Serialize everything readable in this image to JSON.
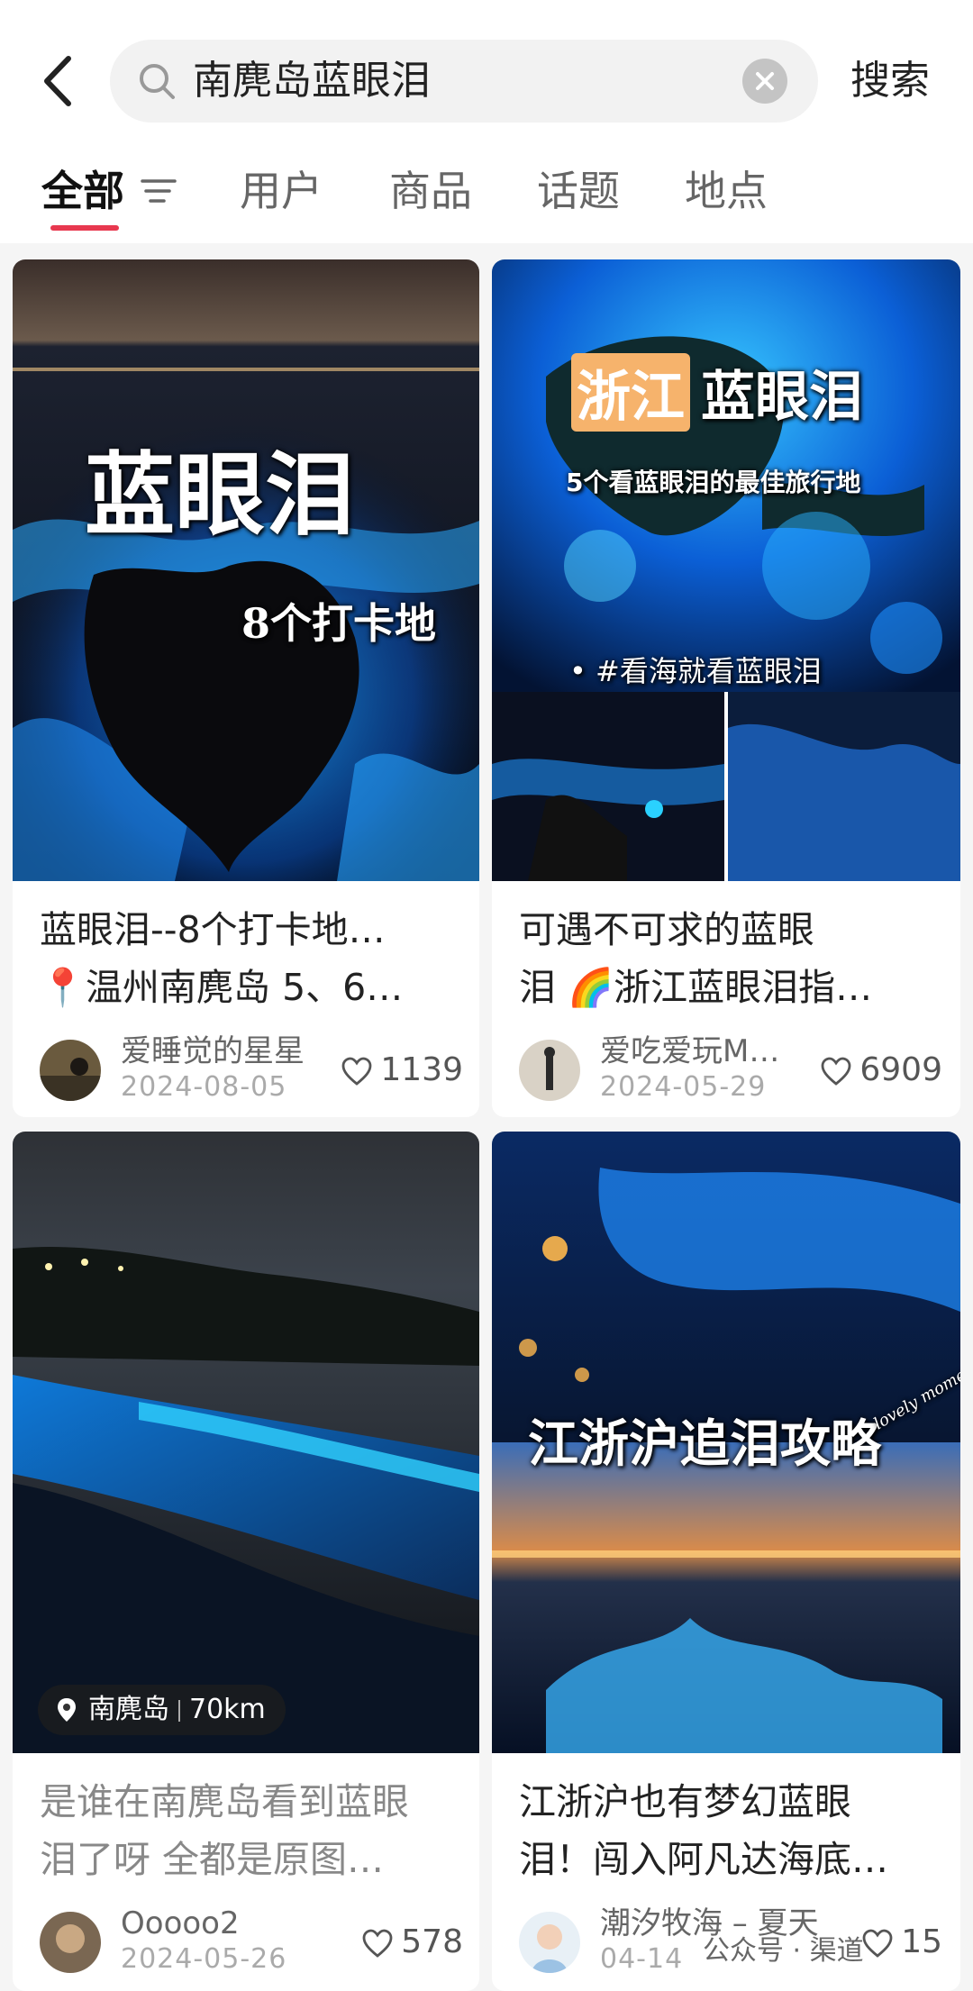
{
  "search": {
    "query": "南麂岛蓝眼泪",
    "submit_label": "搜索"
  },
  "tabs": [
    {
      "label": "全部"
    },
    {
      "label": "用户"
    },
    {
      "label": "商品"
    },
    {
      "label": "话题"
    },
    {
      "label": "地点"
    }
  ],
  "cards": [
    {
      "overlay_main": "蓝眼泪",
      "overlay_sub": "8个打卡地",
      "title_line1": "蓝眼泪--8个打卡地…",
      "title_line2": "📍温州南麂岛 5、6…",
      "author": "爱睡觉的星星",
      "date": "2024-08-05",
      "likes": "1139"
    },
    {
      "overlay_main_a": "浙江",
      "overlay_main_b": "蓝眼泪",
      "overlay_sub": "5个看蓝眼泪的最佳旅行地",
      "overlay_tag": "• #看海就看蓝眼泪",
      "title_line1": "可遇不可求的蓝眼",
      "title_line2": "泪 🌈浙江蓝眼泪指…",
      "author": "爱吃爱玩M…",
      "date": "2024-05-29",
      "likes": "6909"
    },
    {
      "location_name": "南麂岛",
      "location_distance": "70km",
      "title_line1": "是谁在南麂岛看到蓝眼",
      "title_line2": "泪了呀 全都是原图…",
      "author": "Ooooo2",
      "date": "2024-05-26",
      "likes": "578"
    },
    {
      "overlay_main": "江浙沪追泪攻略",
      "overlay_script": "lovely moments",
      "title_line1": "江浙沪也有梦幻蓝眼",
      "title_line2": "泪！闯入阿凡达海底…",
      "author": "潮汐牧海 – 夏天",
      "date": "04-14",
      "likes": "15"
    }
  ],
  "watermark": "公众号 · 渠道"
}
